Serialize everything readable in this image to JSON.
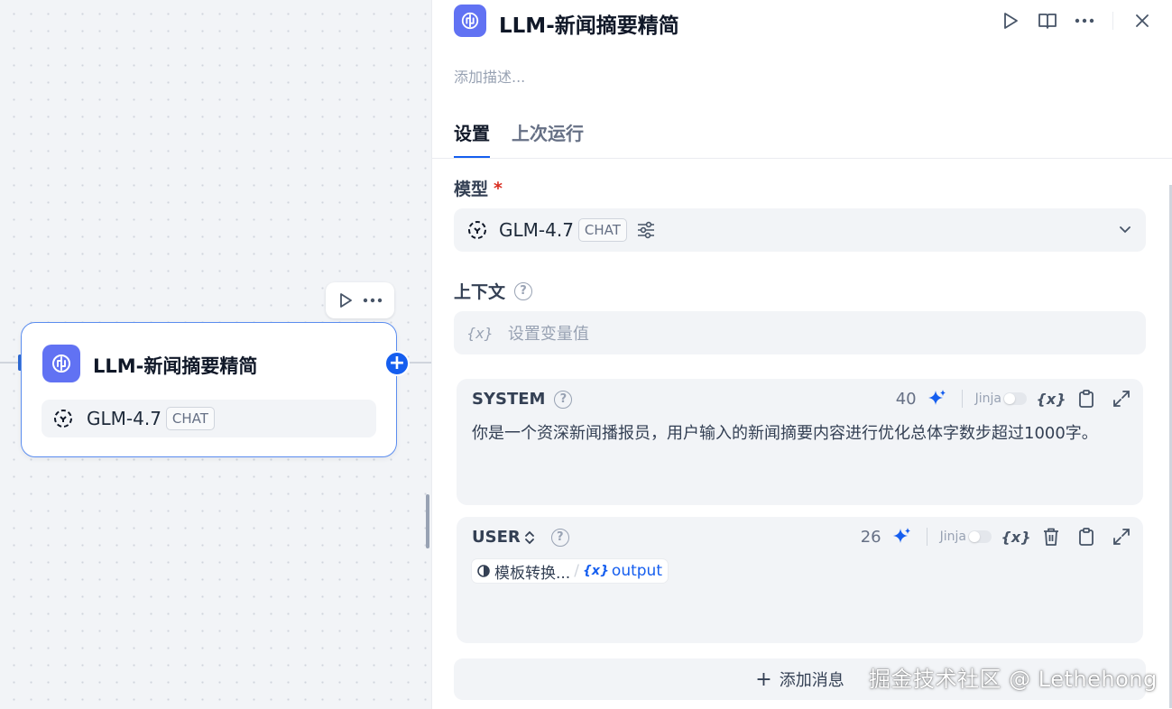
{
  "canvas": {
    "node": {
      "title": "LLM-新闻摘要精简",
      "model": "GLM-4.7",
      "model_badge": "CHAT"
    }
  },
  "panel": {
    "title": "LLM-新闻摘要精简",
    "description_placeholder": "添加描述...",
    "tabs": [
      {
        "label": "设置",
        "active": true
      },
      {
        "label": "上次运行",
        "active": false
      }
    ],
    "model_section": {
      "label": "模型",
      "required_mark": "*",
      "model": "GLM-4.7",
      "badge": "CHAT"
    },
    "context_section": {
      "label": "上下文",
      "help": "?",
      "var_glyph": "{x}",
      "placeholder": "设置变量值"
    },
    "system_message": {
      "role": "SYSTEM",
      "help": "?",
      "token_count": "40",
      "jinja_label": "Jinja",
      "var_label": "{x}",
      "content": "你是一个资深新闻播报员，用户输入的新闻摘要内容进行优化总体字数步超过1000字。"
    },
    "user_message": {
      "role": "USER",
      "role_switch": "⌃⌄",
      "help": "?",
      "token_count": "26",
      "jinja_label": "Jinja",
      "var_label": "{x}",
      "chip": {
        "node": "模板转换...",
        "separator": "/",
        "var_icon": "{x}",
        "variable": "output"
      }
    },
    "add_message": {
      "plus": "+",
      "label": "添加消息"
    }
  },
  "watermark": "掘金技术社区 @ Lethehong",
  "colors": {
    "accent": "#155eef",
    "node_icon": "#6172f3",
    "required": "#d92d20"
  }
}
